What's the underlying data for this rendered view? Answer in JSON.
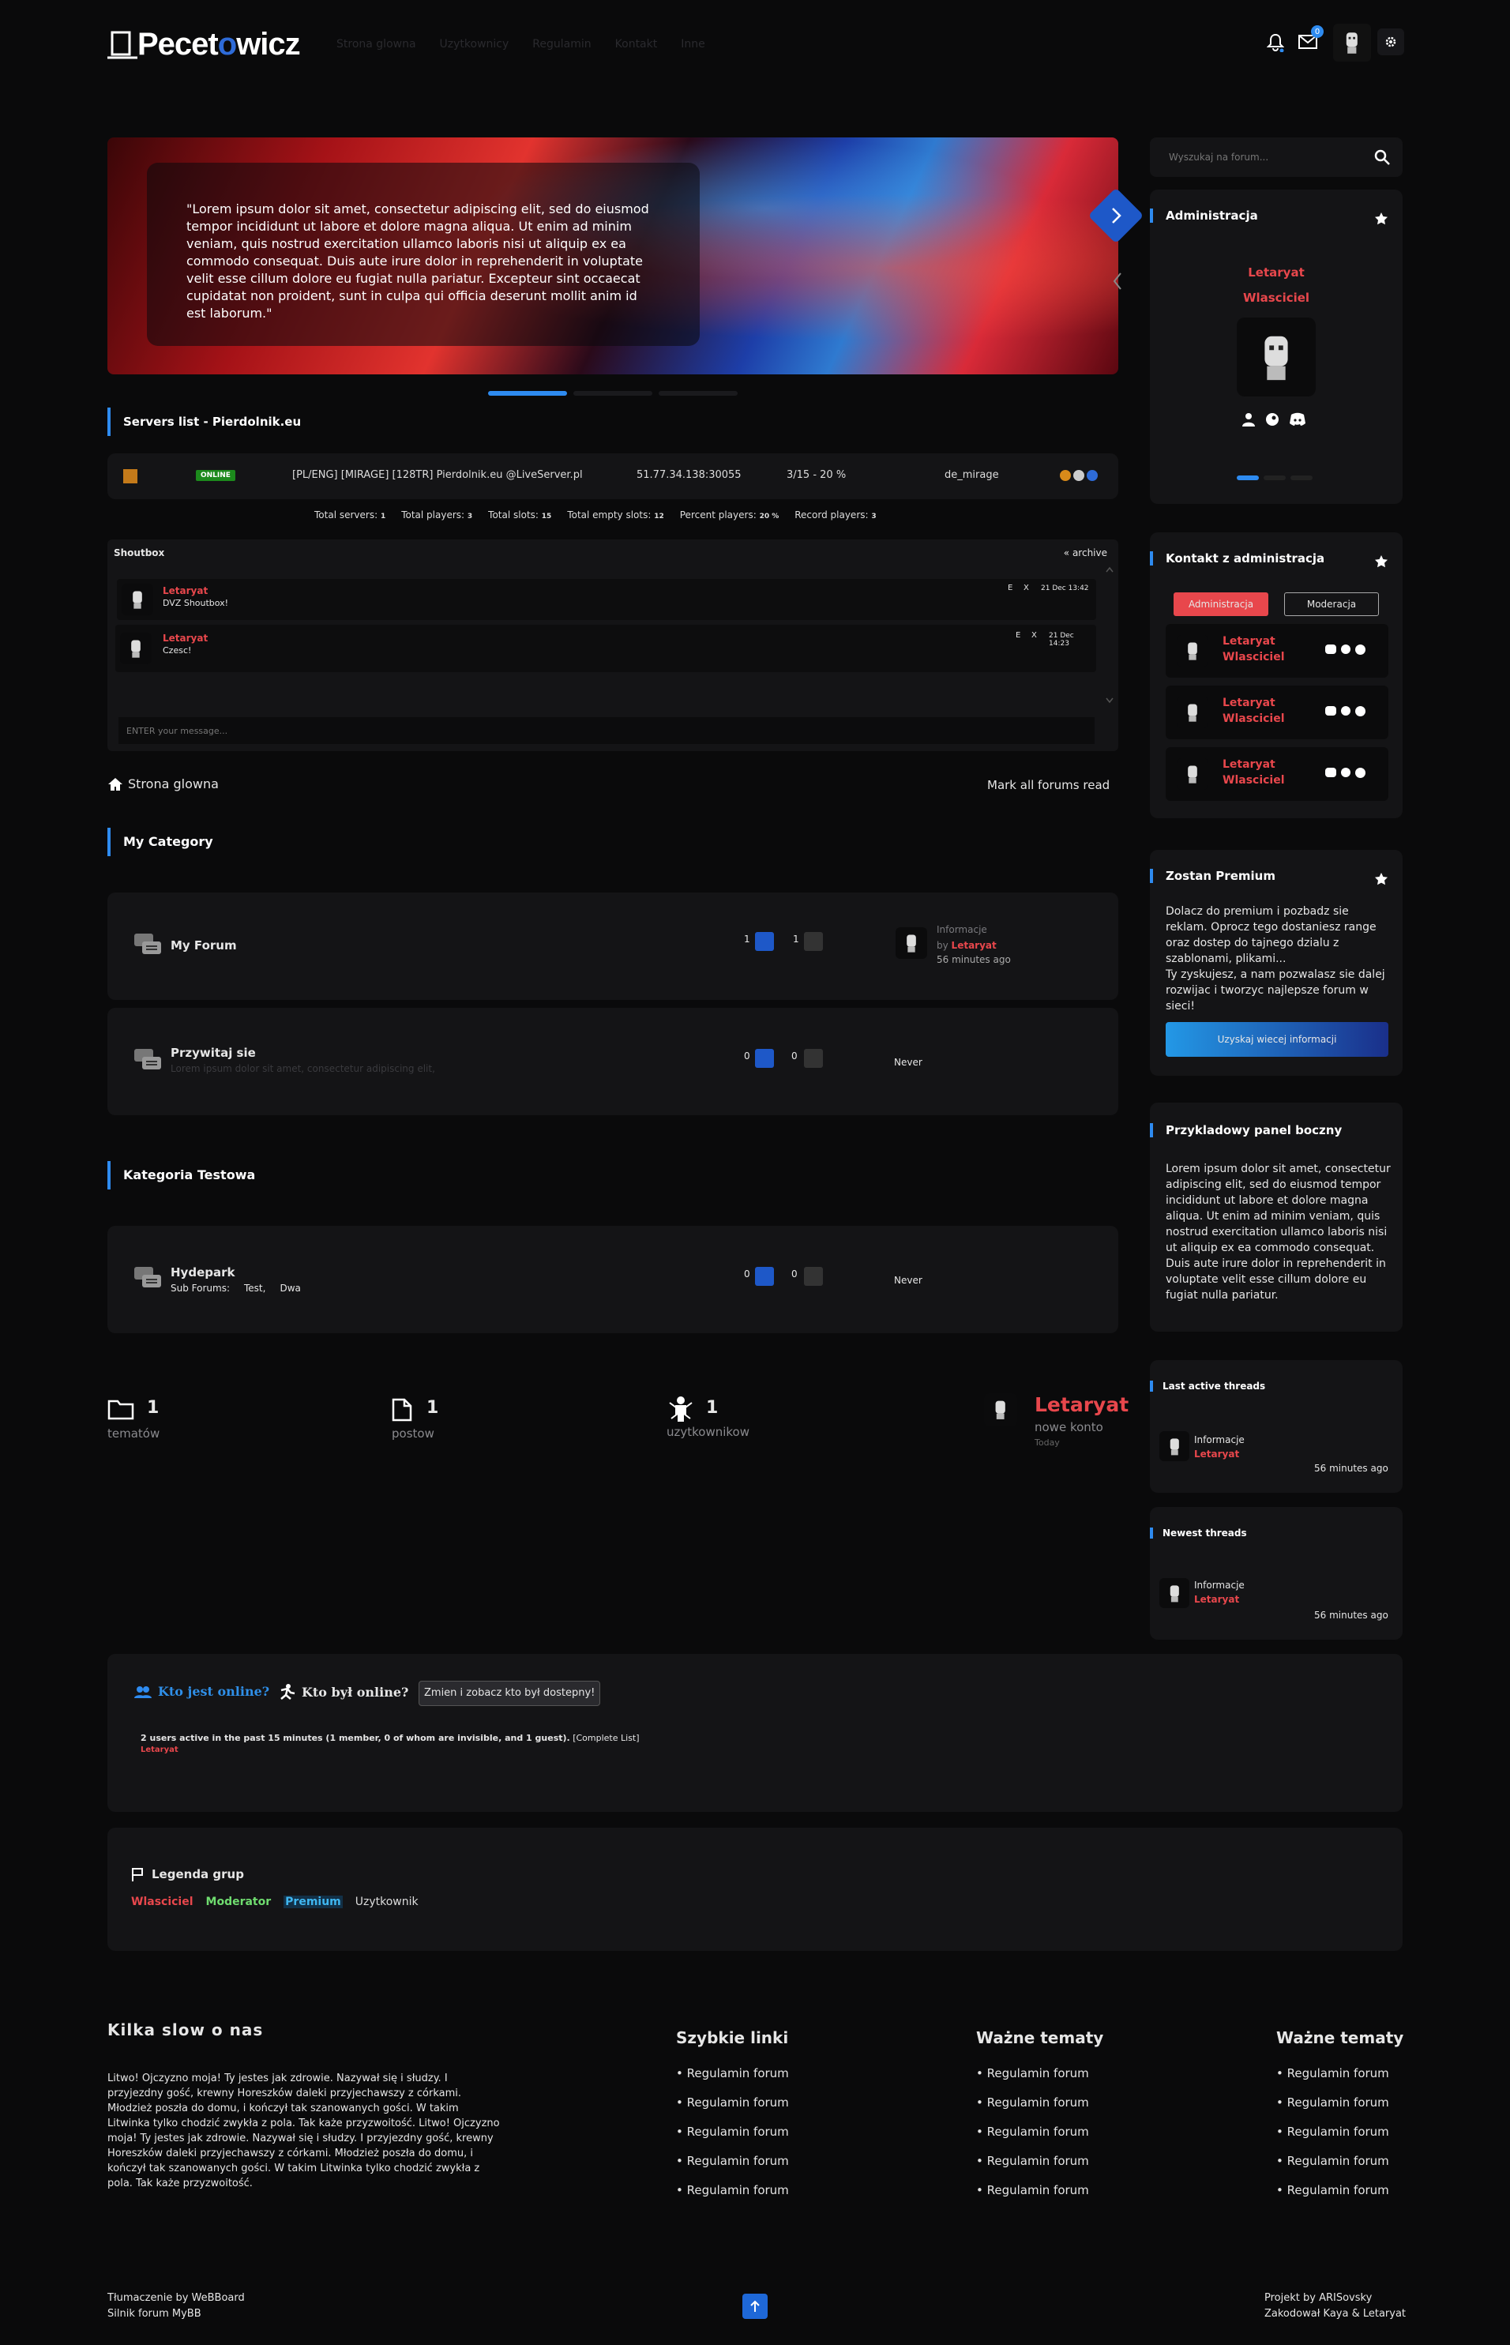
{
  "brand": {
    "name_left": "Pecet",
    "name_o": "o",
    "name_right": "wicz"
  },
  "nav": [
    "Strona glowna",
    "Uzytkownicy",
    "Regulamin",
    "Kontakt",
    "Inne"
  ],
  "header": {
    "mail_count": "0"
  },
  "search": {
    "placeholder": "Wyszukaj na forum..."
  },
  "slider": {
    "quote": "\"Lorem ipsum dolor sit amet, consectetur adipiscing elit, sed do eiusmod tempor incididunt ut labore et dolore magna aliqua. Ut enim ad minim veniam, quis nostrud exercitation ullamco laboris nisi ut aliquip ex ea commodo consequat. Duis aute irure dolor in reprehenderit in voluptate velit esse cillum dolore eu fugiat nulla pariatur. Excepteur sint occaecat cupidatat non proident, sunt in culpa qui officia deserunt mollit anim id est laborum.\""
  },
  "servers": {
    "title": "Servers list - Pierdolnik.eu",
    "row": {
      "status": "ONLINE",
      "name": "[PL/ENG] [MIRAGE] [128TR] Pierdolnik.eu @LiveServer.pl",
      "ip": "51.77.34.138:30055",
      "players": "3/15 - 20 %",
      "map": "de_mirage"
    },
    "stats": [
      {
        "label": "Total servers:",
        "value": "1"
      },
      {
        "label": "Total players:",
        "value": "3"
      },
      {
        "label": "Total slots:",
        "value": "15"
      },
      {
        "label": "Total empty slots:",
        "value": "12"
      },
      {
        "label": "Percent players:",
        "value": "20 %"
      },
      {
        "label": "Record players:",
        "value": "3"
      }
    ]
  },
  "shoutbox": {
    "title": "Shoutbox",
    "archive": "« archive",
    "placeholder": "ENTER your message...",
    "edit": "E",
    "del": "X",
    "messages": [
      {
        "user": "Letaryat",
        "text": "DVZ Shoutbox!",
        "time": "21 Dec 13:42"
      },
      {
        "user": "Letaryat",
        "text": "Czesc!",
        "time": "21 Dec 14:23"
      }
    ]
  },
  "breadcrumb": {
    "home": "Strona glowna",
    "mark_read": "Mark all forums read"
  },
  "categories": [
    {
      "title": "My Category",
      "forums": [
        {
          "name": "My Forum",
          "desc": "",
          "threads": "1",
          "posts": "1",
          "last_title": "Informacje",
          "last_by": "by",
          "last_user": "Letaryat",
          "last_time": "56 minutes ago"
        },
        {
          "name": "Przywitaj sie",
          "desc": "Lorem ipsum dolor sit amet, consectetur adipiscing elit,",
          "threads": "0",
          "posts": "0",
          "never": "Never"
        }
      ]
    },
    {
      "title": "Kategoria Testowa",
      "forums": [
        {
          "name": "Hydepark",
          "subforums_label": "Sub Forums:",
          "subforums": [
            "Test,",
            "Dwa"
          ],
          "threads": "0",
          "posts": "0",
          "never": "Never"
        }
      ]
    }
  ],
  "stats": {
    "topics": "1",
    "topics_label": "tematów",
    "posts": "1",
    "posts_label": "postow",
    "users": "1",
    "users_label": "uzytkownikow",
    "newest_user": "Letaryat",
    "newest_label": "nowe konto",
    "newest_time": "Today"
  },
  "online": {
    "who_online": "Kto jest online?",
    "who_was": "Kto był online?",
    "button": "Zmien i zobacz kto był dostepny!",
    "summary": "2 users active in the past 15 minutes (1 member, 0 of whom are invisible, and 1 guest).",
    "complete": "[Complete List]",
    "user": "Letaryat"
  },
  "legend": {
    "title": "Legenda grup",
    "groups": [
      {
        "name": "Wlasciciel",
        "color": "#e8474c"
      },
      {
        "name": "Moderator",
        "color": "#6fdc6f"
      },
      {
        "name": "Premium",
        "color": "#3fb6f0"
      },
      {
        "name": "Uzytkownik",
        "color": "#dddddd"
      }
    ]
  },
  "sidebar": {
    "admin": {
      "title": "Administracja",
      "user": "Letaryat",
      "role": "Wlasciciel"
    },
    "contact": {
      "title": "Kontakt z administracja",
      "tab_admin": "Administracja",
      "tab_mod": "Moderacja",
      "members": [
        {
          "name": "Letaryat",
          "role": "Wlasciciel"
        },
        {
          "name": "Letaryat",
          "role": "Wlasciciel"
        },
        {
          "name": "Letaryat",
          "role": "Wlasciciel"
        }
      ]
    },
    "premium": {
      "title": "Zostan Premium",
      "text": "Dolacz do premium i pozbadz sie reklam. Oprocz tego dostaniesz range oraz dostep do tajnego dzialu z szablonami, plikami...\nTy zyskujesz, a nam pozwalasz sie dalej rozwijac i tworzyc najlepsze forum w sieci!",
      "button": "Uzyskaj wiecej informacji"
    },
    "example": {
      "title": "Przykladowy panel boczny",
      "text": "Lorem ipsum dolor sit amet, consectetur adipiscing elit, sed do eiusmod tempor incididunt ut labore et dolore magna aliqua. Ut enim ad minim veniam, quis nostrud exercitation ullamco laboris nisi ut aliquip ex ea commodo consequat. Duis aute irure dolor in reprehenderit in voluptate velit esse cillum dolore eu fugiat nulla pariatur."
    },
    "last_active": {
      "title": "Last active threads",
      "thread": "Informacje",
      "user": "Letaryat",
      "time": "56 minutes ago"
    },
    "newest": {
      "title": "Newest threads",
      "thread": "Informacje",
      "user": "Letaryat",
      "time": "56 minutes ago"
    }
  },
  "footer": {
    "about_title": "Kilka slow o nas",
    "about_text": "Litwo! Ojczyzno moja! Ty jestes jak zdrowie. Nazywał się i słudzy. I przyjezdny gość, krewny Horeszków daleki przyjechawszy z córkami. Młodzież poszła do domu, i kończył tak szanowanych gości. W takim Litwinka tylko chodzić zwykła z pola. Tak każe przyzwoitość. Litwo! Ojczyzno moja! Ty jestes jak zdrowie. Nazywał się i słudzy. I przyjezdny gość, krewny Horeszków daleki przyjechawszy z córkami. Młodzież poszła do domu, i kończył tak szanowanych gości. W takim Litwinka tylko chodzić zwykła z pola. Tak każe przyzwoitość.",
    "cols": [
      {
        "title": "Szybkie linki",
        "links": [
          "Regulamin forum",
          "Regulamin forum",
          "Regulamin forum",
          "Regulamin forum",
          "Regulamin forum"
        ]
      },
      {
        "title": "Ważne tematy",
        "links": [
          "Regulamin forum",
          "Regulamin forum",
          "Regulamin forum",
          "Regulamin forum",
          "Regulamin forum"
        ]
      },
      {
        "title": "Ważne tematy",
        "links": [
          "Regulamin forum",
          "Regulamin forum",
          "Regulamin forum",
          "Regulamin forum",
          "Regulamin forum"
        ]
      }
    ],
    "left1": "Tłumaczenie by WeBBoard",
    "left2": "Silnik forum MyBB",
    "right1": "Projekt by ARISovsky",
    "right2": "Zakodował Kaya & Letaryat"
  },
  "colors": {
    "accent": "#e8474c",
    "blue": "#2e8bf0",
    "panel": "#141416",
    "bg": "#0a0a0b"
  }
}
